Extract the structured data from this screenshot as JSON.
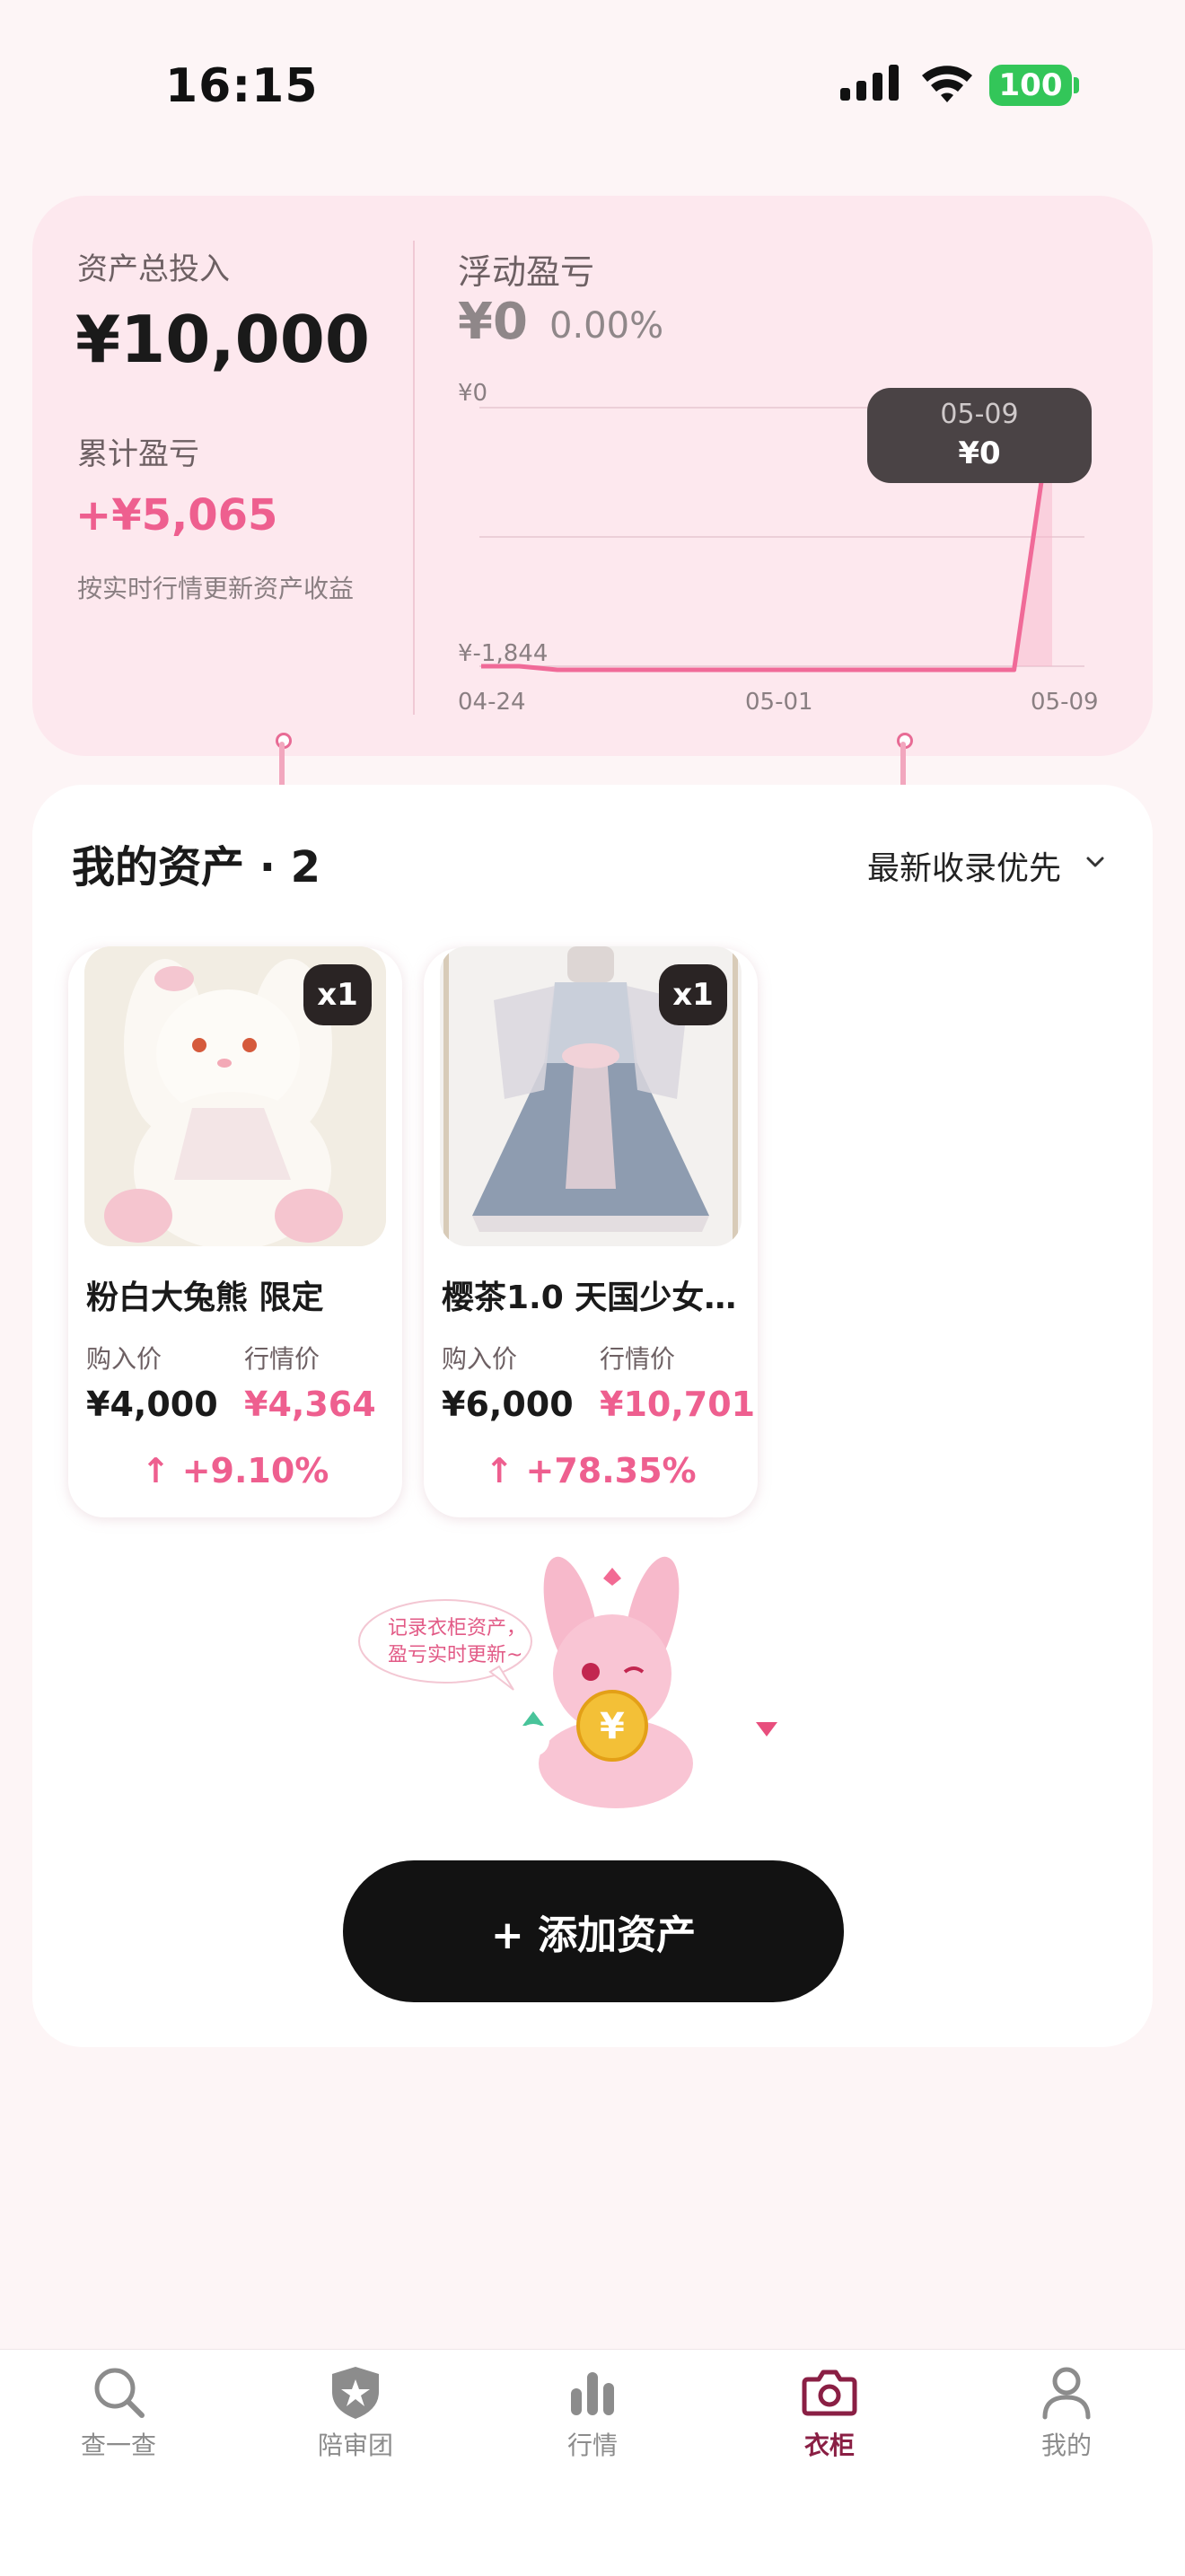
{
  "status_bar": {
    "time": "16:15",
    "battery": "100"
  },
  "summary": {
    "total_label": "资产总投入",
    "total_value": "¥10,000",
    "cum_label": "累计盈亏",
    "cum_value": "+¥5,065",
    "note": "按实时行情更新资产收益",
    "float_label": "浮动盈亏",
    "float_value": "¥0",
    "float_pct": "0.00%"
  },
  "chart_data": {
    "type": "line",
    "x": [
      "04-24",
      "04-25",
      "04-26",
      "04-27",
      "04-28",
      "04-29",
      "04-30",
      "05-01",
      "05-02",
      "05-03",
      "05-04",
      "05-05",
      "05-06",
      "05-07",
      "05-08",
      "05-09"
    ],
    "y": [
      -1844,
      -1844,
      -1860,
      -1860,
      -1860,
      -1860,
      -1856,
      -1856,
      -1856,
      -1856,
      -1856,
      -1852,
      -1852,
      -1852,
      -1852,
      0
    ],
    "xticks": [
      "04-24",
      "05-01",
      "05-09"
    ],
    "yticks": [
      "¥0",
      "¥-1,844"
    ],
    "ylim": [
      -1844,
      0
    ],
    "color": "#f06a98",
    "tooltip": {
      "date": "05-09",
      "value": "¥0"
    }
  },
  "assets": {
    "title": "我的资产 · 2",
    "sort_label": "最新收录优先",
    "items": [
      {
        "name": "粉白大兔熊 限定",
        "qty": "x1",
        "buy_label": "购入价",
        "buy_price": "¥4,000",
        "mkt_label": "行情价",
        "mkt_price": "¥4,364",
        "change": "↑ +9.10%"
      },
      {
        "name": "樱茶1.0 天国少女…",
        "qty": "x1",
        "buy_label": "购入价",
        "buy_price": "¥6,000",
        "mkt_label": "行情价",
        "mkt_price": "¥10,701",
        "change": "↑ +78.35%"
      }
    ],
    "mascot_bubble": [
      "记录衣柜资产，",
      "盈亏实时更新~"
    ],
    "add_button": "+ 添加资产"
  },
  "tabs": [
    {
      "label": "查一查",
      "icon": "search-icon"
    },
    {
      "label": "陪审团",
      "icon": "shield-star-icon"
    },
    {
      "label": "行情",
      "icon": "bar-chart-icon"
    },
    {
      "label": "衣柜",
      "icon": "camera-icon",
      "active": true
    },
    {
      "label": "我的",
      "icon": "person-icon"
    }
  ],
  "colors": {
    "accent_pink": "#ee5f8f",
    "active_tab": "#8a1f44",
    "card_bg": "#fde8ee"
  }
}
